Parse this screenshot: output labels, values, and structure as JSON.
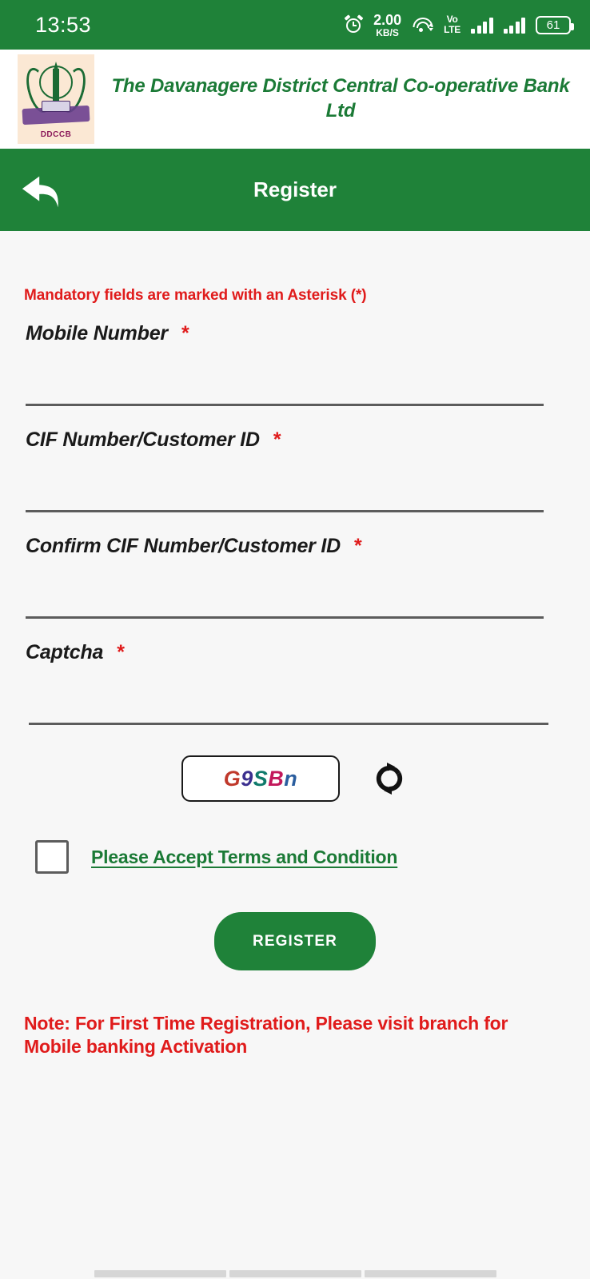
{
  "status_bar": {
    "time": "13:53",
    "network_speed_value": "2.00",
    "network_speed_unit": "KB/S",
    "volte_top": "Vo",
    "volte_bottom": "LTE",
    "battery_level": "61",
    "icons": [
      "alarm-clock-icon",
      "wifi-icon",
      "volte-icon",
      "signal-bars-icon",
      "signal-bars-icon",
      "battery-icon"
    ]
  },
  "bank_header": {
    "title": "The Davanagere District Central Co-operative Bank Ltd",
    "logo_text": "DDCCB",
    "title_color": "#1b7a36",
    "logo_bg": "#fbe8d4"
  },
  "page_header": {
    "title": "Register",
    "back_icon": "back-arrow-icon",
    "bg_color": "#1f8239"
  },
  "form": {
    "mandatory_note": "Mandatory fields are marked with an Asterisk (*)",
    "asterisk": "*",
    "fields": [
      {
        "label": "Mobile Number",
        "value": "",
        "placeholder": "",
        "required": true
      },
      {
        "label": "CIF Number/Customer ID",
        "value": "",
        "placeholder": "",
        "required": true
      },
      {
        "label": "Confirm CIF Number/Customer ID",
        "value": "",
        "placeholder": "",
        "required": true
      },
      {
        "label": "Captcha",
        "value": "",
        "placeholder": "",
        "required": true
      }
    ]
  },
  "captcha": {
    "text": "G9SBn",
    "characters": [
      {
        "char": "G",
        "color": "#c0392b"
      },
      {
        "char": "9",
        "color": "#3b2f8f"
      },
      {
        "char": "S",
        "color": "#0f7a6b"
      },
      {
        "char": "B",
        "color": "#c2185b"
      },
      {
        "char": "n",
        "color": "#2a5d9e"
      }
    ],
    "refresh_icon": "refresh-icon"
  },
  "terms": {
    "label": "Please Accept Terms and Condition",
    "checked": false,
    "link_color": "#1b7a36"
  },
  "actions": {
    "register_label": "REGISTER",
    "register_bg": "#1f8239"
  },
  "note": {
    "text": "Note: For First Time Registration, Please visit branch for Mobile banking Activation",
    "color": "#e01b1b"
  }
}
